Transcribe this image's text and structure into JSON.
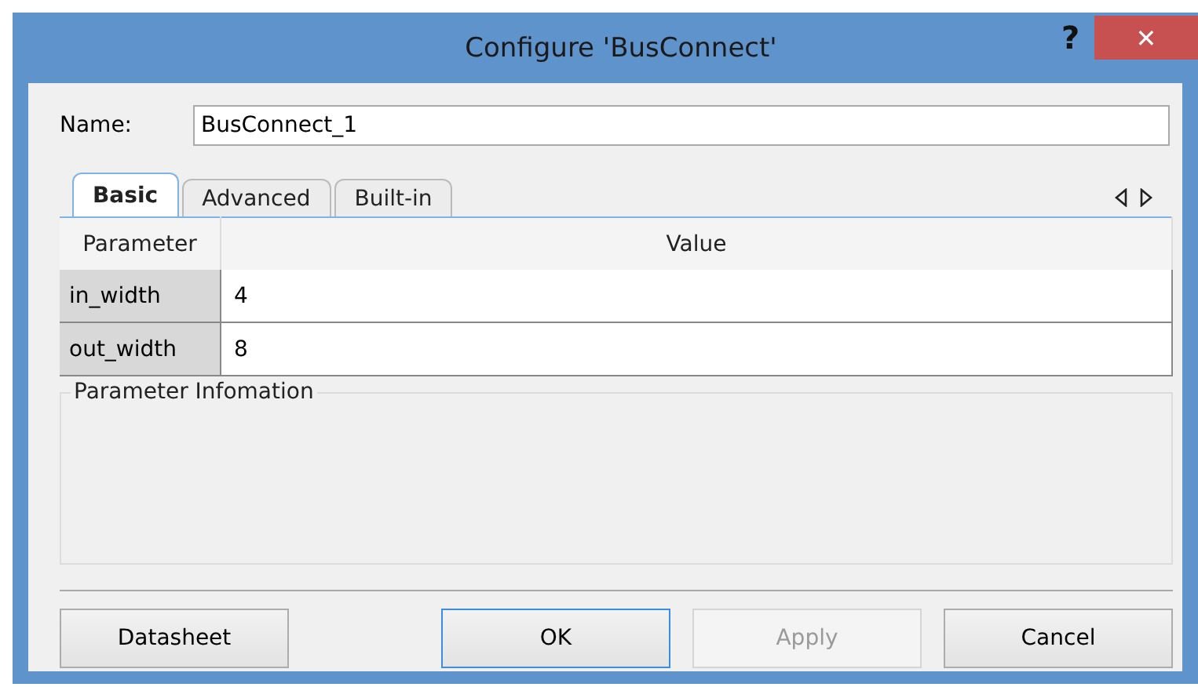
{
  "window": {
    "title": "Configure 'BusConnect'",
    "help": "?",
    "close": "✕"
  },
  "name_field": {
    "label": "Name:",
    "value": "BusConnect_1"
  },
  "tabs": [
    {
      "label": "Basic",
      "selected": true
    },
    {
      "label": "Advanced",
      "selected": false
    },
    {
      "label": "Built-in",
      "selected": false
    }
  ],
  "table": {
    "columns": [
      "Parameter",
      "Value"
    ],
    "rows": [
      {
        "name": "in_width",
        "value": "4"
      },
      {
        "name": "out_width",
        "value": "8"
      }
    ]
  },
  "info_group": {
    "title": "Parameter Infomation"
  },
  "buttons": [
    {
      "label": "Datasheet",
      "kind": "normal"
    },
    {
      "label": "OK",
      "kind": "default"
    },
    {
      "label": "Apply",
      "kind": "disabled"
    },
    {
      "label": "Cancel",
      "kind": "normal"
    }
  ]
}
